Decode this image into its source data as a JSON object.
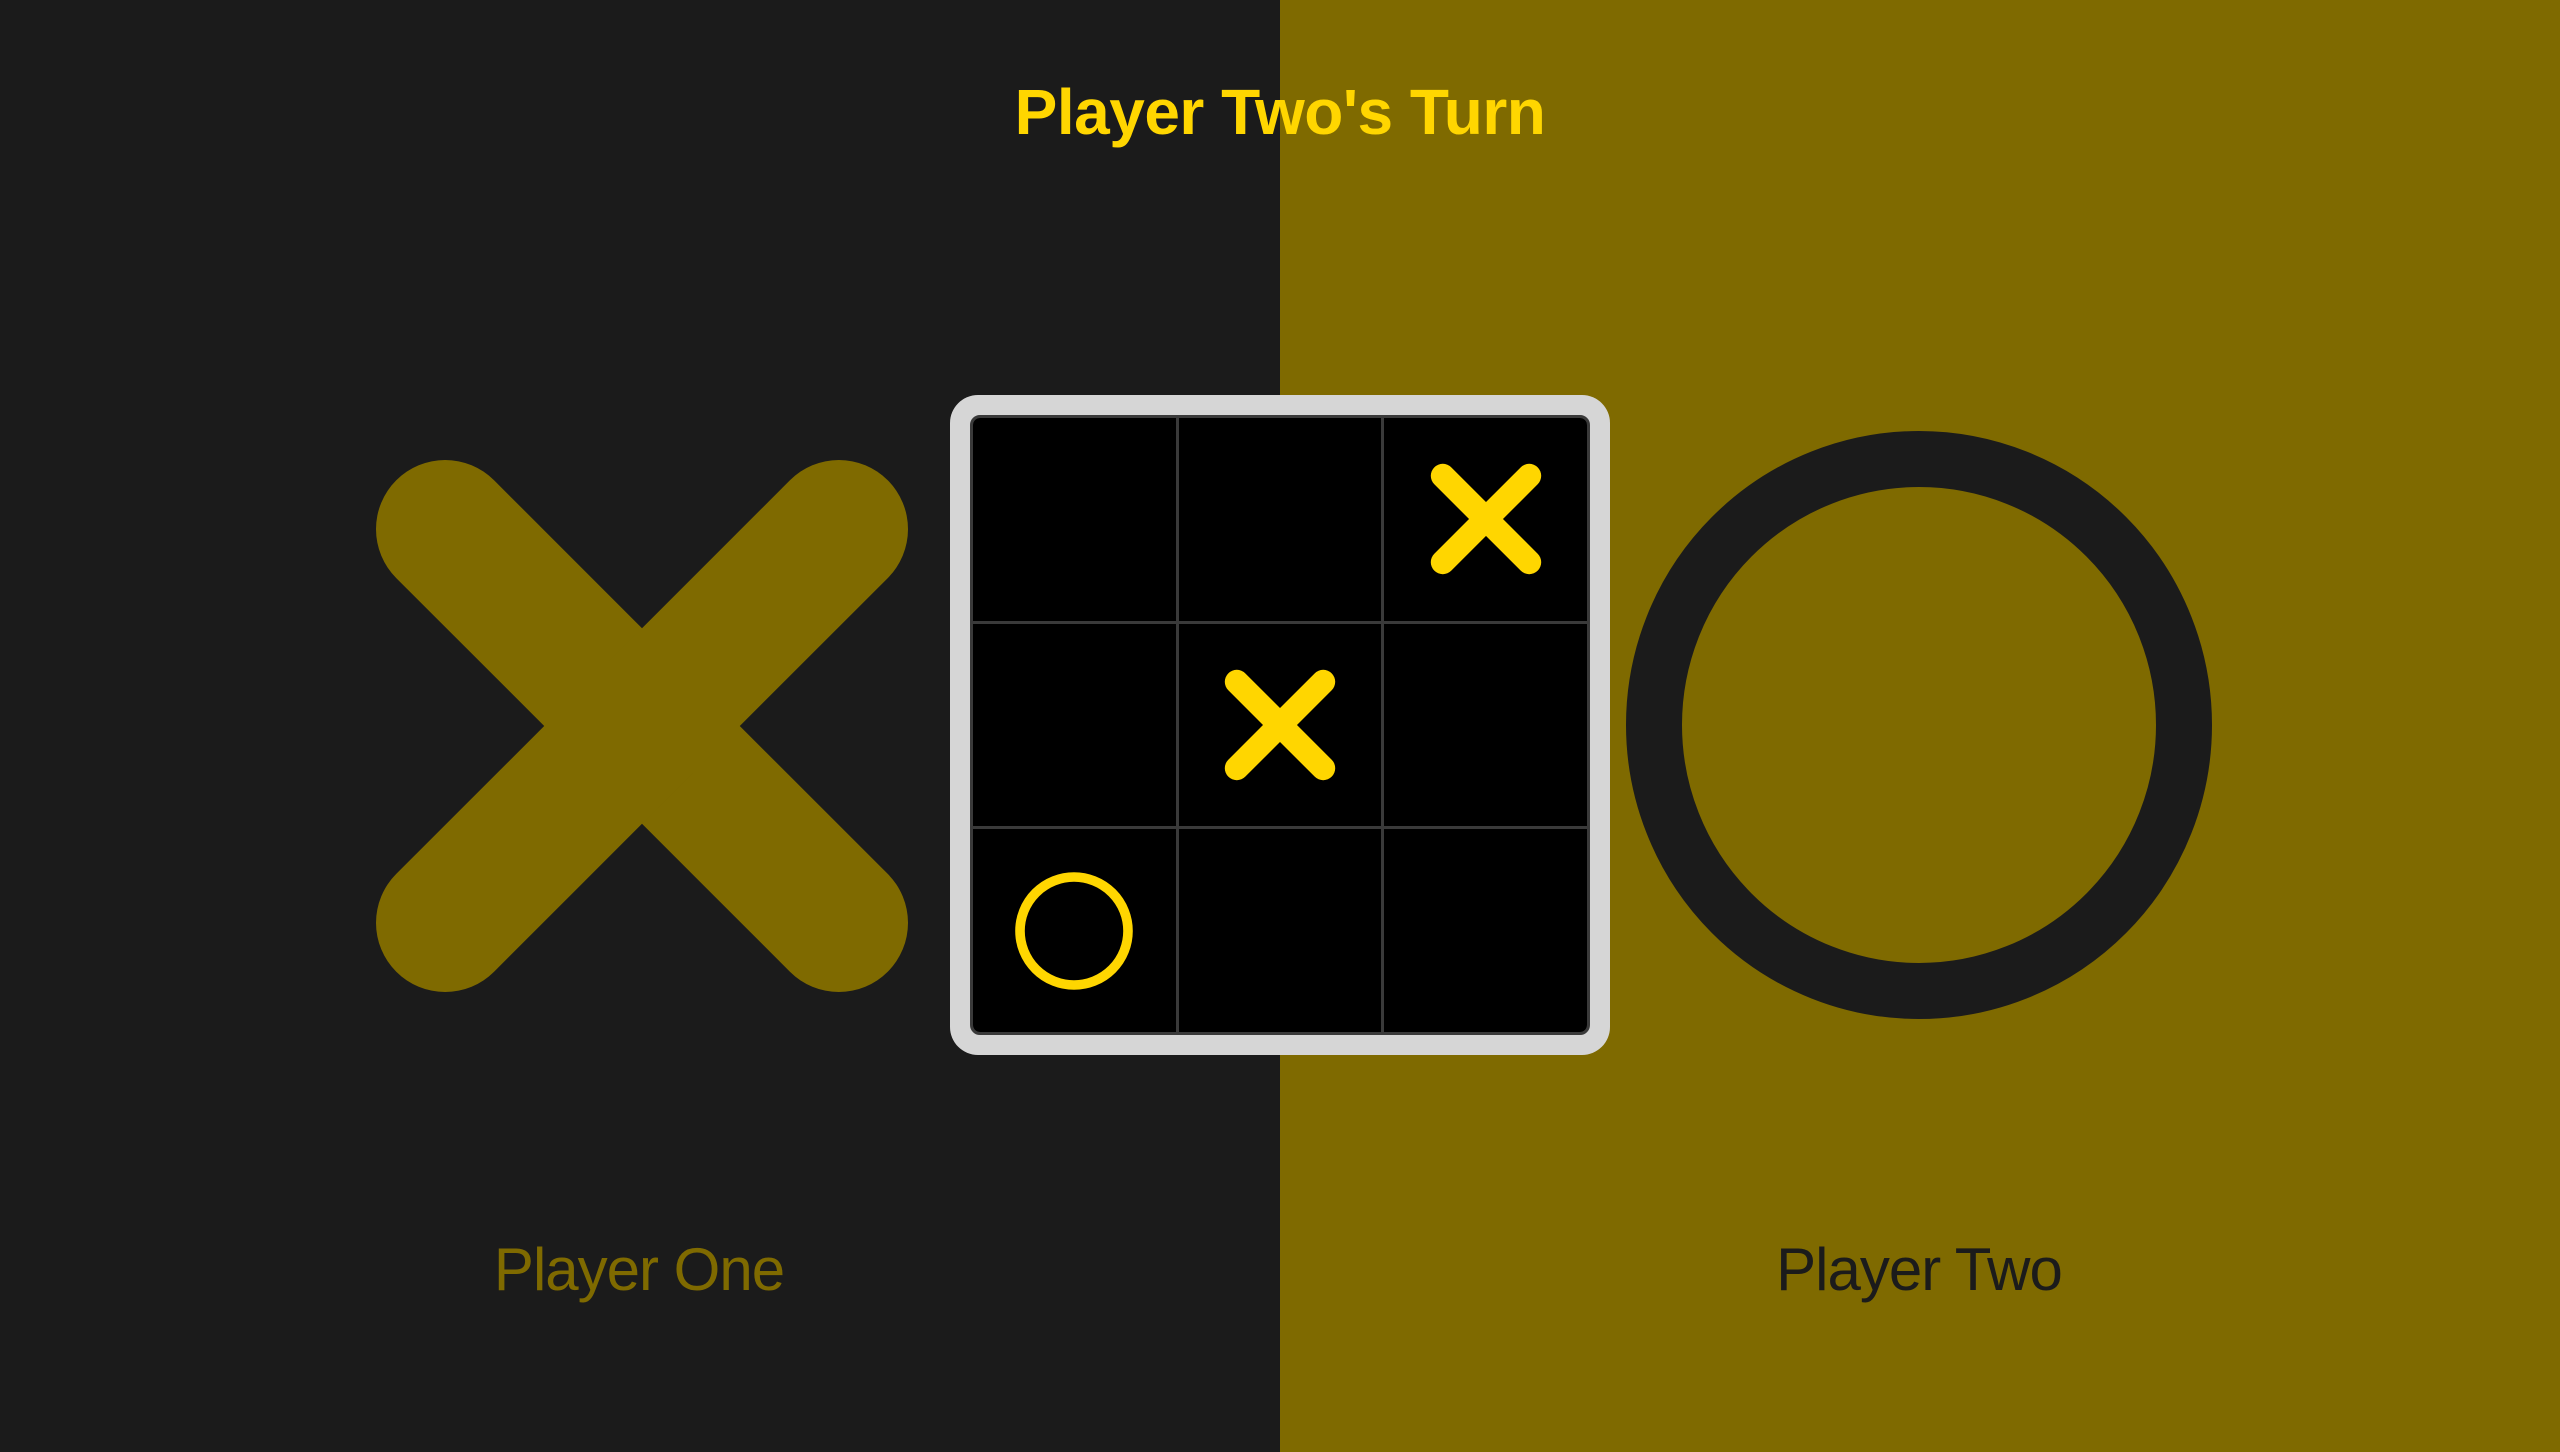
{
  "header": {
    "turn_text": "Player Two's Turn"
  },
  "players": {
    "one": {
      "label": "Player One",
      "symbol": "x-icon"
    },
    "two": {
      "label": "Player Two",
      "symbol": "o-icon"
    }
  },
  "board": {
    "cells": [
      "",
      "",
      "X",
      "",
      "X",
      "",
      "O",
      "",
      ""
    ]
  },
  "colors": {
    "left_background": "#1b1b1b",
    "right_background": "#7f6a00",
    "accent_yellow": "#ffd600",
    "board_frame": "#d6d6d6",
    "cell_background": "#000000"
  }
}
